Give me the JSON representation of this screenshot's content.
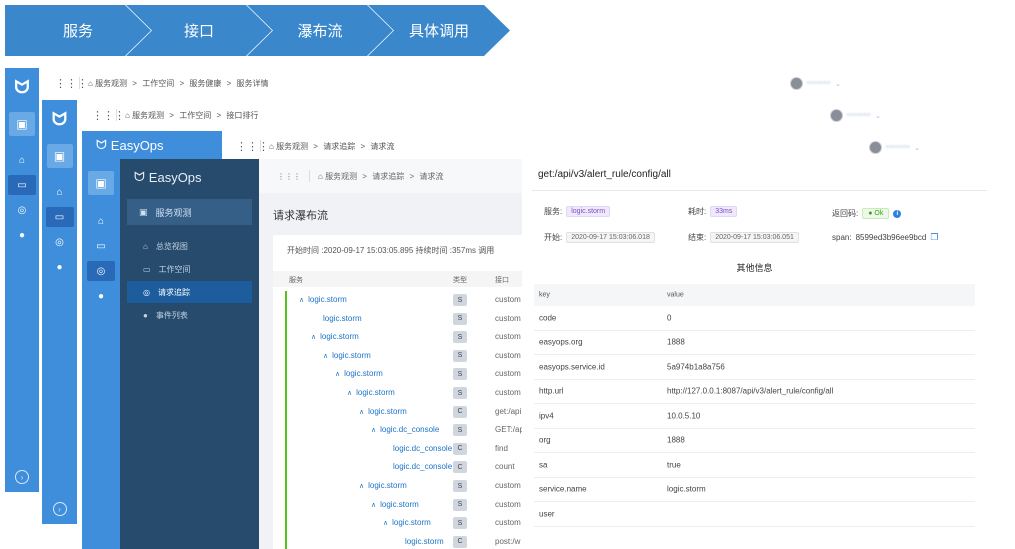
{
  "flow": [
    "服务",
    "接口",
    "瀑布流",
    "具体调用"
  ],
  "brand": "EasyOps",
  "grid_icon": "⋮⋮⋮",
  "breadcrumb_w1": [
    "服务观测",
    ">",
    "工作空间",
    ">",
    "服务健康",
    ">",
    "服务详情"
  ],
  "breadcrumb_w2": [
    "服务观测",
    ">",
    "工作空间",
    ">",
    "接口排行"
  ],
  "breadcrumb_w3": [
    "服务观测",
    ">",
    "请求追踪",
    ">",
    "请求流"
  ],
  "breadcrumb_w4": [
    "服务观测",
    ">",
    "请求追踪",
    ">",
    "请求流"
  ],
  "user_name": "•••••••",
  "nav": {
    "app": "服务观测",
    "items": [
      "总览视图",
      "工作空间",
      "请求追踪",
      "事件列表"
    ],
    "active_index": 2
  },
  "waterfall": {
    "title": "请求瀑布流",
    "summary": "开始时间 :2020-09-17 15:03:05.895   持续时间 :357ms   调用",
    "columns": [
      "服务",
      "类型",
      "接口"
    ],
    "rows": [
      {
        "caret": "∧",
        "service": "logic.storm",
        "type": "S",
        "api": "custom",
        "indent": 10
      },
      {
        "caret": "",
        "service": "logic.storm",
        "type": "S",
        "api": "custom",
        "indent": 34
      },
      {
        "caret": "∧",
        "service": "logic.storm",
        "type": "S",
        "api": "custom",
        "indent": 22
      },
      {
        "caret": "∧",
        "service": "logic.storm",
        "type": "S",
        "api": "custom",
        "indent": 34
      },
      {
        "caret": "∧",
        "service": "logic.storm",
        "type": "S",
        "api": "custom",
        "indent": 46
      },
      {
        "caret": "∧",
        "service": "logic.storm",
        "type": "S",
        "api": "custom",
        "indent": 58
      },
      {
        "caret": "∧",
        "service": "logic.storm",
        "type": "C",
        "api": "get:/api",
        "indent": 70
      },
      {
        "caret": "∧",
        "service": "logic.dc_console",
        "type": "S",
        "api": "GET:/ap",
        "indent": 82
      },
      {
        "caret": "",
        "service": "logic.dc_console",
        "type": "C",
        "api": "find",
        "indent": 104
      },
      {
        "caret": "",
        "service": "logic.dc_console",
        "type": "C",
        "api": "count",
        "indent": 104
      },
      {
        "caret": "∧",
        "service": "logic.storm",
        "type": "S",
        "api": "custom",
        "indent": 70
      },
      {
        "caret": "∧",
        "service": "logic.storm",
        "type": "S",
        "api": "custom",
        "indent": 82
      },
      {
        "caret": "∧",
        "service": "logic.storm",
        "type": "S",
        "api": "custom",
        "indent": 94
      },
      {
        "caret": "",
        "service": "logic.storm",
        "type": "C",
        "api": "post:/w",
        "indent": 116
      }
    ]
  },
  "detail": {
    "title": "get:/api/v3/alert_rule/config/all",
    "service_label": "服务:",
    "service_value": "logic.storm",
    "duration_label": "耗时:",
    "duration_value": "33ms",
    "return_label": "返回码:",
    "return_value": "Ok",
    "start_label": "开始:",
    "start_value": "2020-09-17 15:03:06.018",
    "end_label": "结束:",
    "end_value": "2020-09-17 15:03:06.051",
    "span_label": "span:",
    "span_value": "8599ed3b96ee9bcd",
    "other_title": "其他信息",
    "kv_head": {
      "key": "key",
      "value": "value"
    },
    "kv": [
      {
        "k": "code",
        "v": "0"
      },
      {
        "k": "easyops.org",
        "v": "1888"
      },
      {
        "k": "easyops.service.id",
        "v": "5a974b1a8a756"
      },
      {
        "k": "http.url",
        "v": "http://127.0.0.1:8087/api/v3/alert_rule/config/all"
      },
      {
        "k": "ipv4",
        "v": "10.0.5.10"
      },
      {
        "k": "org",
        "v": "1888"
      },
      {
        "k": "sa",
        "v": "true"
      },
      {
        "k": "service.name",
        "v": "logic.storm"
      },
      {
        "k": "user",
        "v": ""
      }
    ]
  },
  "colors": {
    "primary": "#3f8edb",
    "chevron": "#3a87cc",
    "nav_dark": "#274b6d",
    "link": "#1a73c7"
  }
}
